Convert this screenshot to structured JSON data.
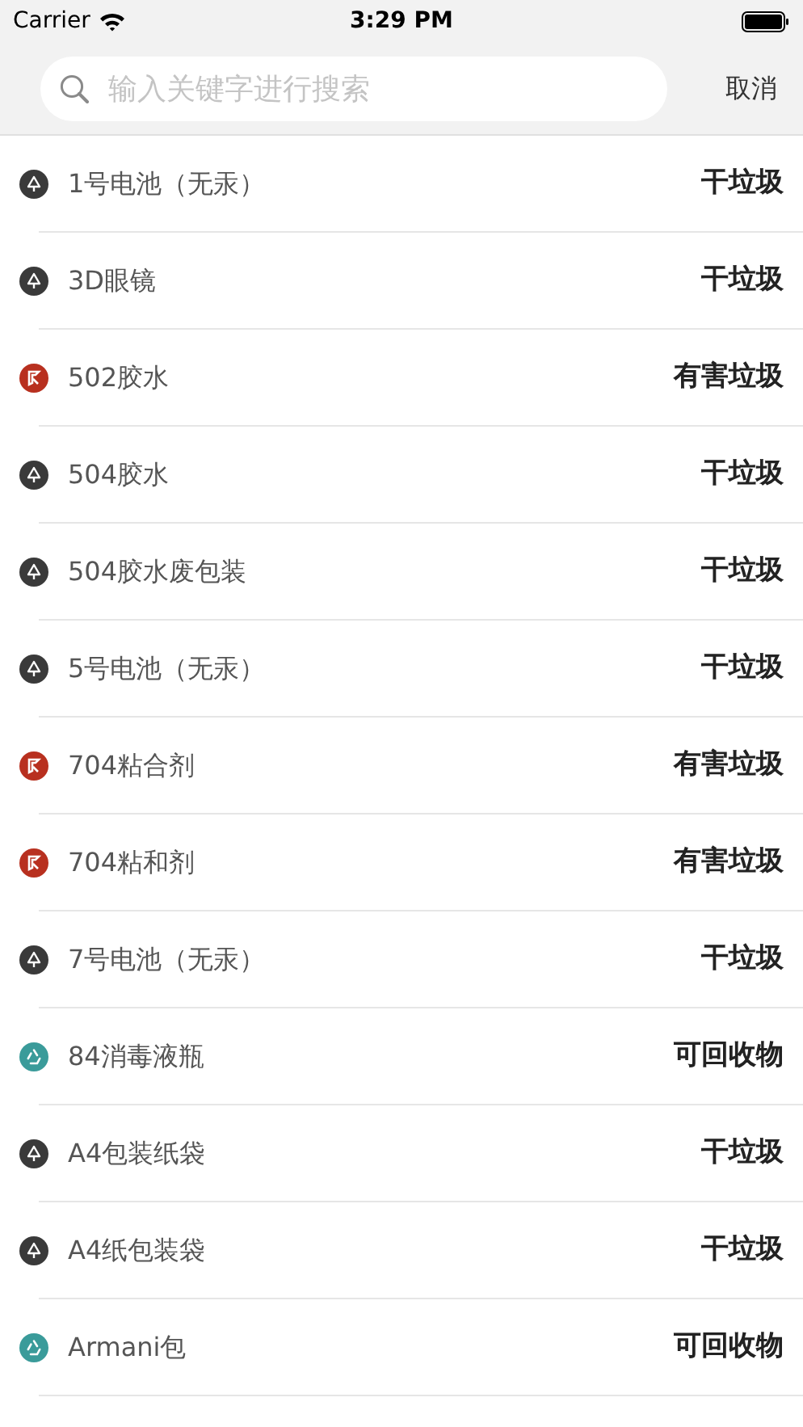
{
  "status_bar": {
    "carrier": "Carrier",
    "time": "3:29 PM"
  },
  "search": {
    "placeholder": "输入关键字进行搜索",
    "cancel": "取消"
  },
  "items": [
    {
      "name": "1号电池（无汞）",
      "category": "干垃圾",
      "kind": "dry",
      "color": "#3a3a3a"
    },
    {
      "name": "3D眼镜",
      "category": "干垃圾",
      "kind": "dry",
      "color": "#3a3a3a"
    },
    {
      "name": "502胶水",
      "category": "有害垃圾",
      "kind": "hazardous",
      "color": "#b8301f"
    },
    {
      "name": "504胶水",
      "category": "干垃圾",
      "kind": "dry",
      "color": "#3a3a3a"
    },
    {
      "name": "504胶水废包装",
      "category": "干垃圾",
      "kind": "dry",
      "color": "#3a3a3a"
    },
    {
      "name": "5号电池（无汞）",
      "category": "干垃圾",
      "kind": "dry",
      "color": "#3a3a3a"
    },
    {
      "name": "704粘合剂",
      "category": "有害垃圾",
      "kind": "hazardous",
      "color": "#b8301f"
    },
    {
      "name": "704粘和剂",
      "category": "有害垃圾",
      "kind": "hazardous",
      "color": "#b8301f"
    },
    {
      "name": "7号电池（无汞）",
      "category": "干垃圾",
      "kind": "dry",
      "color": "#3a3a3a"
    },
    {
      "name": "84消毒液瓶",
      "category": "可回收物",
      "kind": "recyclable",
      "color": "#3a9b9a"
    },
    {
      "name": "A4包装纸袋",
      "category": "干垃圾",
      "kind": "dry",
      "color": "#3a3a3a"
    },
    {
      "name": "A4纸包装袋",
      "category": "干垃圾",
      "kind": "dry",
      "color": "#3a3a3a"
    },
    {
      "name": "Armani包",
      "category": "可回收物",
      "kind": "recyclable",
      "color": "#3a9b9a"
    }
  ]
}
